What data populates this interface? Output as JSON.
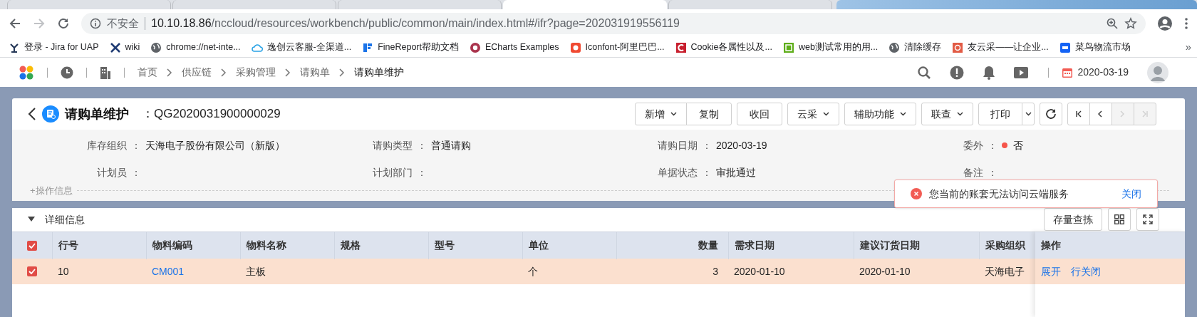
{
  "browser": {
    "tabs": [
      {
        "selected": false
      },
      {
        "selected": false
      },
      {
        "selected": false
      },
      {
        "selected": true
      },
      {
        "selected": false
      }
    ],
    "address": {
      "security": "不安全",
      "host": "10.10.18.86",
      "path": "/nccloud/resources/workbench/public/common/main/index.html#/ifr?page=202031919556119"
    },
    "bookmarks": [
      {
        "kind": "jira",
        "label": "登录 - Jira for UAP"
      },
      {
        "kind": "wiki",
        "label": "wiki"
      },
      {
        "kind": "globe",
        "label": "chrome://net-inte..."
      },
      {
        "kind": "cloud",
        "label": "逸创云客服-全渠道..."
      },
      {
        "kind": "finereport",
        "label": "FineReport帮助文档"
      },
      {
        "kind": "echarts",
        "label": "ECharts Examples"
      },
      {
        "kind": "iconfont",
        "label": "Iconfont-阿里巴巴..."
      },
      {
        "kind": "cookie",
        "label": "Cookie各属性以及..."
      },
      {
        "kind": "guan",
        "label": "web测试常用的用..."
      },
      {
        "kind": "globe",
        "label": "清除缓存"
      },
      {
        "kind": "youyun",
        "label": "友云采——让企业..."
      },
      {
        "kind": "cainiao",
        "label": "菜鸟物流市场"
      }
    ],
    "more": "»"
  },
  "header": {
    "breadcrumbs": [
      {
        "label": "首页",
        "current": false
      },
      {
        "label": "供应链",
        "current": false
      },
      {
        "label": "采购管理",
        "current": false
      },
      {
        "label": "请购单",
        "current": false
      },
      {
        "label": "请购单维护",
        "current": true
      }
    ],
    "date": "2020-03-19"
  },
  "bill": {
    "title": "请购单维护",
    "number": "：QG2020031900000029",
    "toolbar": [
      {
        "kind": "group",
        "buttons": [
          {
            "label": "新增",
            "dropdown": true
          },
          {
            "label": "复制",
            "dropdown": false
          }
        ]
      },
      {
        "kind": "group",
        "buttons": [
          {
            "label": "收回",
            "dropdown": false
          }
        ]
      },
      {
        "kind": "group",
        "buttons": [
          {
            "label": "云采",
            "dropdown": true
          }
        ]
      },
      {
        "kind": "group",
        "buttons": [
          {
            "label": "辅助功能",
            "dropdown": true
          }
        ]
      },
      {
        "kind": "group",
        "buttons": [
          {
            "label": "联查",
            "dropdown": true
          }
        ]
      },
      {
        "kind": "split",
        "label": "打印"
      },
      {
        "kind": "refresh"
      },
      {
        "kind": "pager",
        "buttons": [
          {
            "disabled": false
          },
          {
            "disabled": false
          },
          {
            "disabled": true
          },
          {
            "disabled": true
          }
        ]
      }
    ],
    "fields": [
      {
        "label": "库存组织",
        "separator": "：",
        "value": "天海电子股份有限公司（新版）",
        "kind": "text"
      },
      {
        "label": "请购类型",
        "separator": "：",
        "value": "普通请购",
        "kind": "text"
      },
      {
        "label": "请购日期",
        "separator": "：",
        "value": "2020-03-19",
        "kind": "text"
      },
      {
        "label": "委外",
        "separator": "：",
        "value": "否",
        "kind": "status",
        "color": "#f5544a"
      },
      {
        "label": "计划员",
        "separator": "：",
        "kind": "text"
      },
      {
        "label": "计划部门",
        "separator": "：",
        "kind": "text"
      },
      {
        "label": "单据状态",
        "separator": "：",
        "value": "审批通过",
        "kind": "text"
      },
      {
        "label": "备注",
        "separator": "：",
        "kind": "text"
      }
    ],
    "more_info": "+操作信息"
  },
  "toast": {
    "message": "您当前的账套无法访问云端服务",
    "close": "关闭"
  },
  "detail": {
    "title": "详细信息",
    "expanded": true,
    "buttons": [
      "存量查拣"
    ],
    "table": {
      "all_checked": true,
      "columns": [
        {
          "label": "行号",
          "numeric": false
        },
        {
          "label": "物料编码",
          "numeric": false
        },
        {
          "label": "物料名称",
          "numeric": false
        },
        {
          "label": "规格",
          "numeric": false
        },
        {
          "label": "型号",
          "numeric": false
        },
        {
          "label": "单位",
          "numeric": false
        },
        {
          "label": "数量",
          "numeric": true
        },
        {
          "label": "需求日期",
          "numeric": false
        },
        {
          "label": "建议订货日期",
          "numeric": false
        },
        {
          "label": "采购组织",
          "numeric": false
        }
      ],
      "action_column": "操作",
      "rows": [
        {
          "checked": true,
          "selected": true,
          "cells": [
            "10",
            "CM001",
            "主板",
            "",
            "",
            "个",
            "3",
            "2020-01-10",
            "2020-01-10",
            "天海电子"
          ],
          "actions": [
            "展开",
            "行关闭"
          ]
        }
      ]
    }
  }
}
